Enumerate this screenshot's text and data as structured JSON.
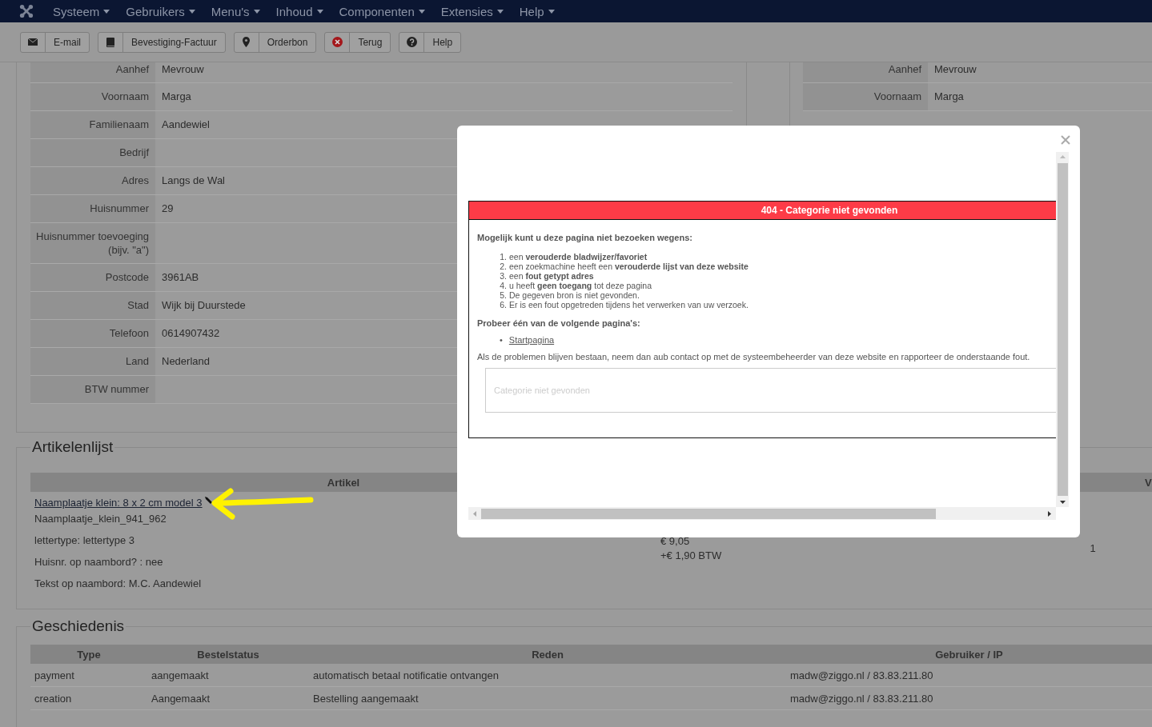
{
  "navbar": {
    "menus": [
      {
        "label": "Systeem"
      },
      {
        "label": "Gebruikers"
      },
      {
        "label": "Menu's"
      },
      {
        "label": "Inhoud"
      },
      {
        "label": "Componenten"
      },
      {
        "label": "Extensies"
      },
      {
        "label": "Help"
      }
    ]
  },
  "toolbar": {
    "buttons": [
      {
        "label": "E-mail"
      },
      {
        "label": "Bevestiging-Factuur"
      },
      {
        "label": "Orderbon"
      },
      {
        "label": "Terug"
      },
      {
        "label": "Help"
      }
    ]
  },
  "customer_left": {
    "rows": [
      {
        "label": "Aanhef",
        "value": "Mevrouw"
      },
      {
        "label": "Voornaam",
        "value": "Marga"
      },
      {
        "label": "Familienaam",
        "value": "Aandewiel"
      },
      {
        "label": "Bedrijf",
        "value": ""
      },
      {
        "label": "Adres",
        "value": "Langs de Wal"
      },
      {
        "label": "Huisnummer",
        "value": "29"
      },
      {
        "label": "Huisnummer toevoeging\n(bijv. \"a\")",
        "value": ""
      },
      {
        "label": "Postcode",
        "value": "3961AB"
      },
      {
        "label": "Stad",
        "value": "Wijk bij Duurstede"
      },
      {
        "label": "Telefoon",
        "value": "0614907432"
      },
      {
        "label": "Land",
        "value": "Nederland"
      },
      {
        "label": "BTW nummer",
        "value": ""
      }
    ]
  },
  "customer_right": {
    "rows": [
      {
        "label": "Aanhef",
        "value": "Mevrouw"
      },
      {
        "label": "Voornaam",
        "value": "Marga"
      }
    ]
  },
  "articles": {
    "title": "Artikelenlijst",
    "columns": [
      {
        "label": "Artikel"
      },
      {
        "label": "V"
      }
    ],
    "rows": [
      {
        "link": "Naamplaatje klein: 8 x 2 cm model 3",
        "details": [
          "Naamplaatje_klein_941_962",
          "lettertype: lettertype 3",
          "Huisnr. op naambord? : nee",
          "Tekst op naambord: M.C. Aandewiel"
        ],
        "price": [
          "€ 9,05",
          "+€ 1,90 BTW"
        ],
        "quantity": "1"
      }
    ]
  },
  "history": {
    "title": "Geschiedenis",
    "columns": [
      "Type",
      "Bestelstatus",
      "Reden",
      "Gebruiker / IP"
    ],
    "rows": [
      [
        "payment",
        "aangemaakt",
        "automatisch betaal notificatie ontvangen",
        "madw@ziggo.nl / 83.83.211.80"
      ],
      [
        "creation",
        "Aangemaakt",
        "Bestelling aangemaakt",
        "madw@ziggo.nl / 83.83.211.80"
      ]
    ]
  },
  "modal": {
    "error_title": "404 - Categorie niet gevonden",
    "intro": "Mogelijk kunt u deze pagina niet bezoeken wegens:",
    "reasons": [
      {
        "marker": "1.",
        "text": "een **verouderde bladwijzer/favoriet**"
      },
      {
        "marker": "2.",
        "text": "een zoekmachine heeft een **verouderde lijst van deze website**"
      },
      {
        "marker": "3.",
        "text": "een **fout getypt adres**"
      },
      {
        "marker": "4.",
        "text": "u heeft **geen toegang** tot deze pagina"
      },
      {
        "marker": "5.",
        "text": "De gegeven bron is niet gevonden."
      },
      {
        "marker": "6.",
        "text": "Er is een fout opgetreden tijdens het verwerken van uw verzoek."
      }
    ],
    "try_text": "Probeer één van de volgende pagina's:",
    "links": [
      {
        "marker": "•",
        "label": "Startpagina"
      }
    ],
    "footer": "Als de problemen blijven bestaan, neem dan aub contact op met de systeembeheerder van deze website en rapporteer de onderstaande fout.",
    "error_message": "Categorie niet gevonden"
  }
}
